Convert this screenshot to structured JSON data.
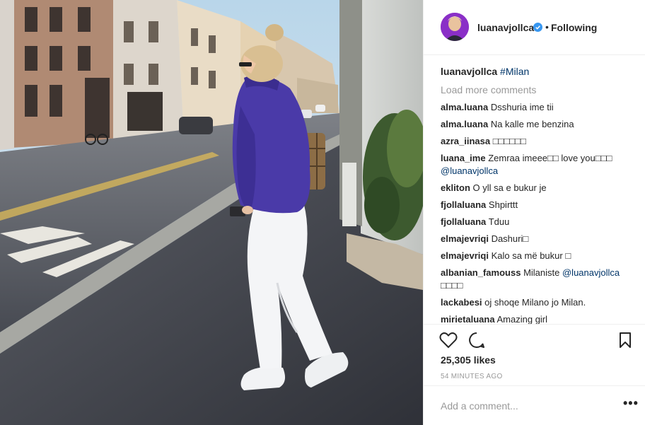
{
  "post": {
    "username": "luanavjollca",
    "follow_status": "Following",
    "separator": "•",
    "caption_user": "luanavjollca",
    "caption_tag": "#Milan",
    "load_more": "Load more comments",
    "comments": [
      {
        "user": "alma.luana",
        "text": "Dsshuria ime tii"
      },
      {
        "user": "alma.luana",
        "text": "Na kalle me benzina"
      },
      {
        "user": "azra_iinasa",
        "text": "□□□□□□"
      },
      {
        "user": "luana_ime",
        "text": "Zemraa imeee□□ love you□□□",
        "mention": "@luanavjollca"
      },
      {
        "user": "ekliton",
        "text": "O yll sa e bukur je"
      },
      {
        "user": "fjollaluana",
        "text": "Shpirttt"
      },
      {
        "user": "fjollaluana",
        "text": "Tduu"
      },
      {
        "user": "elmajevriqi",
        "text": "Dashuri□"
      },
      {
        "user": "elmajevriqi",
        "text": "Kalo sa më bukur □"
      },
      {
        "user": "albanian_famouss",
        "text": "Milaniste",
        "mention": "@luanavjollca",
        "text2": "□□□□"
      },
      {
        "user": "lackabesi",
        "text": "oj shoqe Milano jo Milan."
      },
      {
        "user": "mirietaluana",
        "text": "Amazing girl"
      }
    ],
    "likes": "25,305 likes",
    "time_ago": "54 MINUTES AGO",
    "add_comment_placeholder": "Add a comment...",
    "more_options": "•••",
    "icons": {
      "like": "heart-icon",
      "comment": "comment-icon",
      "save": "bookmark-icon",
      "verified": "verified-badge-icon"
    },
    "colors": {
      "verified": "#3897f0",
      "link": "#003569",
      "muted": "#999999"
    }
  }
}
